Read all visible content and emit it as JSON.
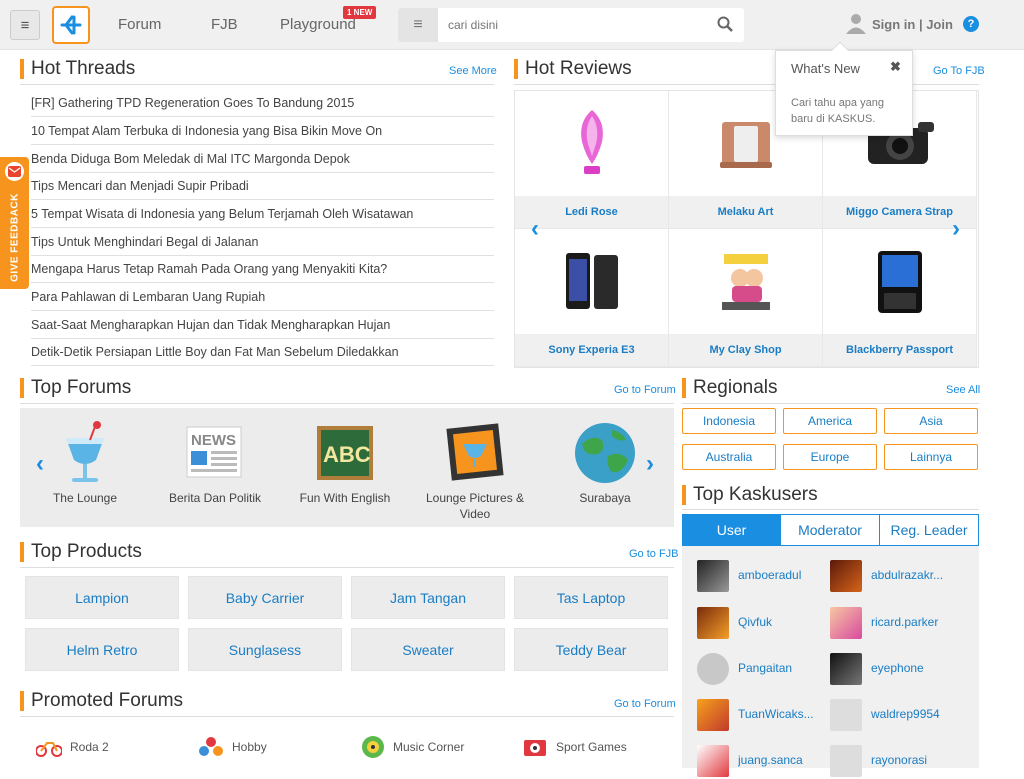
{
  "header": {
    "nav": [
      {
        "label": "Forum"
      },
      {
        "label": "FJB"
      },
      {
        "label": "Playground"
      }
    ],
    "new_badge": "1 NEW",
    "search_placeholder": "cari disini",
    "signin": "Sign in | Join",
    "help": "?"
  },
  "whats_new": {
    "title": "What's New",
    "close": "✖",
    "desc": "Cari tahu apa yang baru di KASKUS."
  },
  "feedback": {
    "label": "GIVE FEEDBACK"
  },
  "hot_threads": {
    "title": "Hot Threads",
    "link": "See More",
    "items": [
      "[FR] Gathering TPD Regeneration Goes To Bandung 2015",
      "10 Tempat Alam Terbuka di Indonesia yang Bisa Bikin Move On",
      "Benda Diduga Bom Meledak di Mal ITC Margonda Depok",
      "Tips Mencari dan Menjadi Supir Pribadi",
      "5 Tempat Wisata di Indonesia yang Belum Terjamah Oleh Wisatawan",
      "Tips Untuk Menghindari Begal di Jalanan",
      "Mengapa Harus Tetap Ramah Pada Orang yang Menyakiti Kita?",
      "Para Pahlawan di Lembaran Uang Rupiah",
      "Saat-Saat Mengharapkan Hujan dan Tidak Mengharapkan Hujan",
      "Detik-Detik Persiapan Little Boy dan Fat Man Sebelum Diledakkan"
    ]
  },
  "hot_reviews": {
    "title": "Hot Reviews",
    "link": "Go To FJB",
    "items": [
      {
        "label": "Ledi Rose"
      },
      {
        "label": "Melaku Art"
      },
      {
        "label": "Miggo Camera Strap"
      },
      {
        "label": "Sony Experia E3"
      },
      {
        "label": "My Clay Shop"
      },
      {
        "label": "Blackberry Passport"
      }
    ]
  },
  "top_forums": {
    "title": "Top Forums",
    "link": "Go to Forum",
    "items": [
      {
        "label": "The Lounge"
      },
      {
        "label": "Berita Dan Politik"
      },
      {
        "label": "Fun With English"
      },
      {
        "label": "Lounge Pictures & Video"
      },
      {
        "label": "Surabaya"
      }
    ],
    "news_icon_text": "NEWS",
    "abc_icon_text": "ABC"
  },
  "top_products": {
    "title": "Top Products",
    "link": "Go to FJB",
    "items": [
      "Lampion",
      "Baby Carrier",
      "Jam Tangan",
      "Tas Laptop",
      "Helm Retro",
      "Sunglasess",
      "Sweater",
      "Teddy Bear"
    ]
  },
  "promoted_forums": {
    "title": "Promoted Forums",
    "link": "Go to Forum",
    "items": [
      "Roda 2",
      "Hobby",
      "Music Corner",
      "Sport Games"
    ]
  },
  "regionals": {
    "title": "Regionals",
    "link": "See All",
    "items": [
      "Indonesia",
      "America",
      "Asia",
      "Australia",
      "Europe",
      "Lainnya"
    ]
  },
  "top_kaskusers": {
    "title": "Top Kaskusers",
    "tabs": [
      "User",
      "Moderator",
      "Reg. Leader"
    ],
    "users": [
      "amboeradul",
      "abdulrazakr...",
      "Qivfuk",
      "ricard.parker",
      "Pangaitan",
      "eyephone",
      "TuanWicaks...",
      "waldrep9954",
      "juang.sanca",
      "rayonorasi"
    ]
  },
  "colors": {
    "accent": "#f7941d",
    "link": "#1a8ee0"
  }
}
